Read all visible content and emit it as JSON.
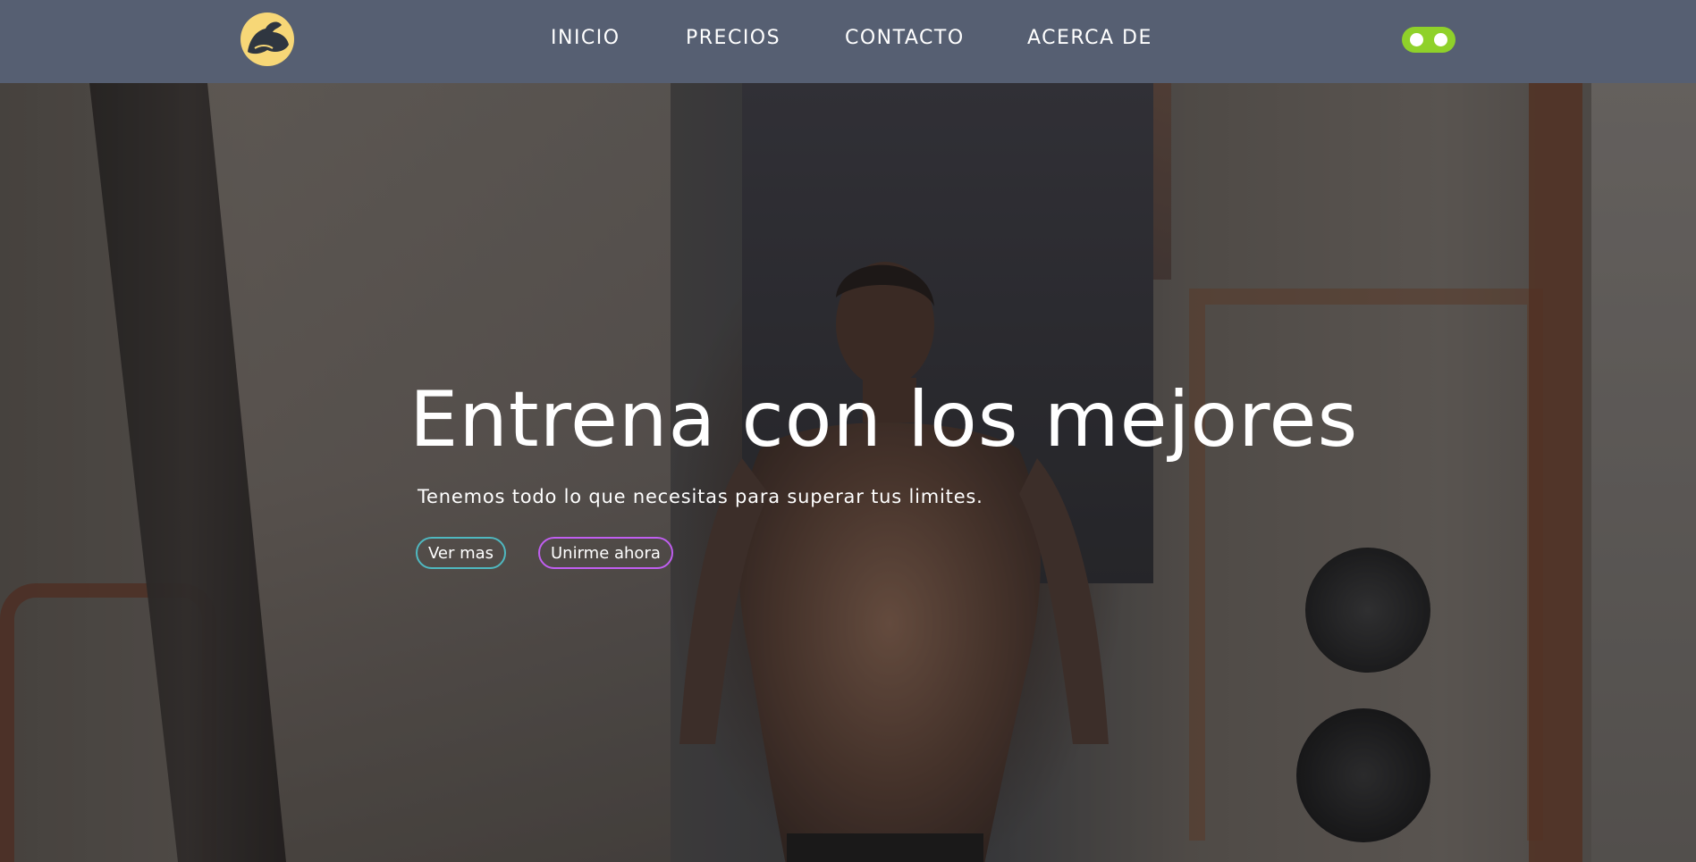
{
  "nav": {
    "logo_icon": "flexed-arm-icon",
    "links": [
      {
        "label": "INICIO"
      },
      {
        "label": "PRECIOS"
      },
      {
        "label": "CONTACTO"
      },
      {
        "label": "ACERCA DE"
      }
    ],
    "theme_toggle_color": "#8fd12a"
  },
  "hero": {
    "title": "Entrena con los mejores",
    "subtitle": "Tenemos todo lo que necesitas para superar tus limites.",
    "buttons": {
      "ver_mas": "Ver mas",
      "unirme": "Unirme ahora"
    },
    "ver_mas_border_color": "#4fb8c0",
    "unirme_border_color": "#c05ef0"
  },
  "colors": {
    "navbar_bg": "#565f72",
    "logo_bg": "#f7d777"
  }
}
